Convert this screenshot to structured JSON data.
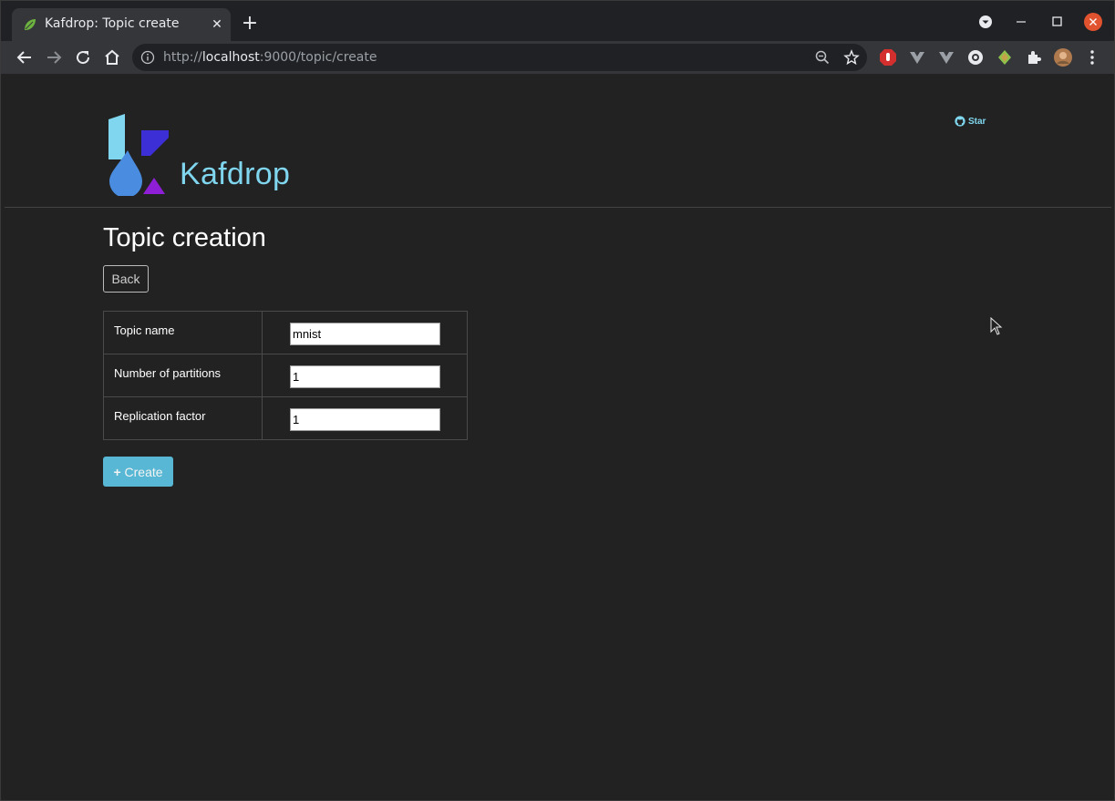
{
  "browser": {
    "tab_title": "Kafdrop: Topic create",
    "tab_close": "✕",
    "new_tab": "+",
    "url_scheme": "http://",
    "url_host": "localhost",
    "url_rest": ":9000/topic/create"
  },
  "header": {
    "brand": "Kafdrop",
    "star_label": "Star"
  },
  "page": {
    "title": "Topic creation",
    "back_label": "Back",
    "create_label": "Create",
    "create_icon": "+"
  },
  "form": {
    "rows": [
      {
        "label": "Topic name",
        "value": "mnist"
      },
      {
        "label": "Number of partitions",
        "value": "1"
      },
      {
        "label": "Replication factor",
        "value": "1"
      }
    ]
  },
  "colors": {
    "page_bg": "#222222",
    "brand": "#7fd6ee",
    "create_button": "#5bc0de",
    "close_button": "#e0532e"
  }
}
